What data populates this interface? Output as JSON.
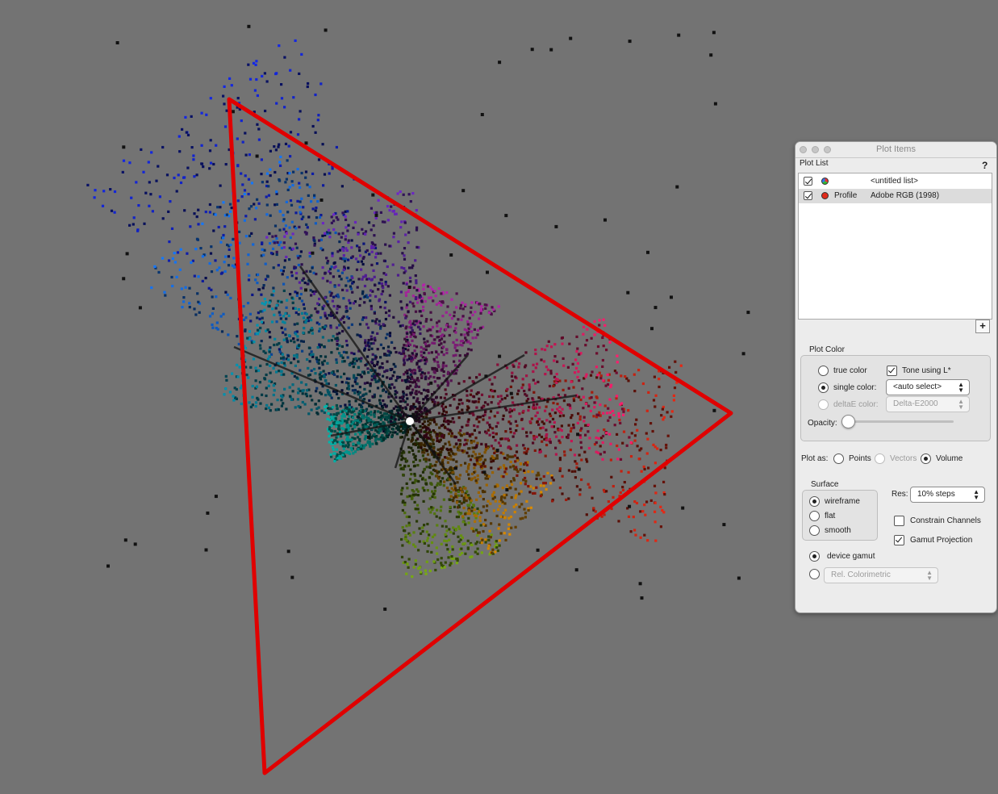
{
  "app": {
    "window_title": "Plot Items",
    "help_label": "?"
  },
  "plot_list": {
    "heading": "Plot List",
    "items": [
      {
        "checked": true,
        "type": "",
        "name": "<untitled list>",
        "icon": "multicolor-swatch-icon"
      },
      {
        "checked": true,
        "type": "Profile",
        "name": "Adobe RGB (1998)",
        "icon": "red-swatch-icon",
        "selected": true
      }
    ],
    "add_button_label": "+"
  },
  "plot_color": {
    "heading": "Plot Color",
    "true_color_label": "true color",
    "single_color_label": "single color:",
    "deltae_color_label": "deltaE color:",
    "tone_label": "Tone using L*",
    "tone_checked": true,
    "single_color_value": "<auto select>",
    "deltae_value": "Delta-E2000",
    "selected": "single",
    "opacity_label": "Opacity:",
    "opacity_value": 0
  },
  "plot_as": {
    "label": "Plot as:",
    "options": [
      "Points",
      "Vectors",
      "Volume"
    ],
    "selected": "Volume"
  },
  "surface": {
    "heading": "Surface",
    "options": [
      "wireframe",
      "flat",
      "smooth"
    ],
    "selected": "wireframe"
  },
  "res": {
    "label": "Res:",
    "value": "10% steps"
  },
  "constrain_channels": {
    "label": "Constrain Channels",
    "checked": false
  },
  "gamut_projection": {
    "label": "Gamut Projection",
    "checked": true
  },
  "gamut_source": {
    "device_gamut_label": "device gamut",
    "intent_value": "Rel. Colorimetric",
    "selected": "device"
  },
  "plot": {
    "background": "#737373",
    "gamut_outline_color": "#e00000",
    "center_color": "#ffffff"
  }
}
